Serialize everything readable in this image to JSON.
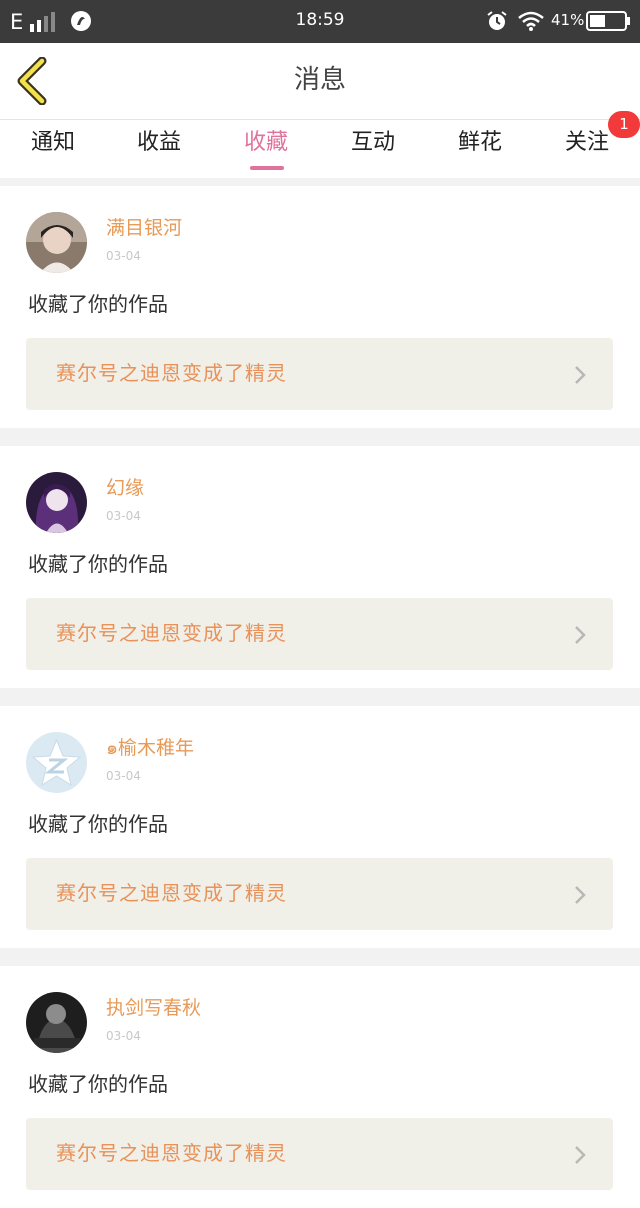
{
  "status_bar": {
    "network": "E",
    "time": "18:59",
    "battery_percent": "41%"
  },
  "header": {
    "title": "消息",
    "back_icon": "chevron-left-icon"
  },
  "tabs": [
    {
      "label": "通知",
      "active": false
    },
    {
      "label": "收益",
      "active": false
    },
    {
      "label": "收藏",
      "active": true
    },
    {
      "label": "互动",
      "active": false
    },
    {
      "label": "鲜花",
      "active": false
    },
    {
      "label": "关注",
      "active": false,
      "badge": "1"
    }
  ],
  "colors": {
    "accent": "#e0739c",
    "username": "#e89a57",
    "work_title": "#e8925a",
    "work_bg": "#f1f0e8",
    "badge": "#f23a3a"
  },
  "messages": [
    {
      "username": "满目银河",
      "date": "03-04",
      "action": "收藏了你的作品",
      "work_title": "赛尔号之迪恩变成了精灵"
    },
    {
      "username": "幻缘",
      "date": "03-04",
      "action": "收藏了你的作品",
      "work_title": "赛尔号之迪恩变成了精灵"
    },
    {
      "username": "๑榆木稚年",
      "date": "03-04",
      "action": "收藏了你的作品",
      "work_title": "赛尔号之迪恩变成了精灵"
    },
    {
      "username": "执剑写春秋",
      "date": "03-04",
      "action": "收藏了你的作品",
      "work_title": "赛尔号之迪恩变成了精灵"
    }
  ]
}
